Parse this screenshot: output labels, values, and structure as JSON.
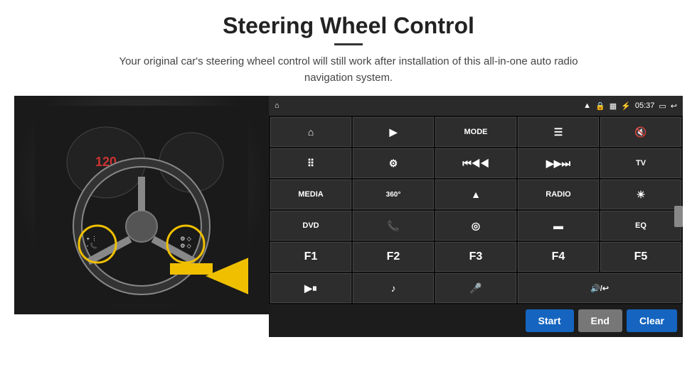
{
  "page": {
    "title": "Steering Wheel Control",
    "subtitle": "Your original car's steering wheel control will still work after installation of this all-in-one auto radio navigation system."
  },
  "status_bar": {
    "time": "05:37",
    "icons": [
      "wifi",
      "lock",
      "sim",
      "bluetooth",
      "volume",
      "screen",
      "back"
    ]
  },
  "buttons": [
    {
      "id": "r0c0",
      "label": "⌂",
      "type": "icon"
    },
    {
      "id": "r0c1",
      "label": "▷",
      "type": "icon"
    },
    {
      "id": "r0c2",
      "label": "MODE",
      "type": "text"
    },
    {
      "id": "r0c3",
      "label": "☰",
      "type": "icon"
    },
    {
      "id": "r0c4",
      "label": "🔇",
      "type": "icon"
    },
    {
      "id": "r0c5",
      "label": "⠿",
      "type": "icon"
    },
    {
      "id": "r1c0",
      "label": "⚙",
      "type": "icon"
    },
    {
      "id": "r1c1",
      "label": "◀|◀◀",
      "type": "icon"
    },
    {
      "id": "r1c2",
      "label": "▶▶|→",
      "type": "icon"
    },
    {
      "id": "r1c3",
      "label": "TV",
      "type": "text"
    },
    {
      "id": "r1c4",
      "label": "MEDIA",
      "type": "text"
    },
    {
      "id": "r2c0",
      "label": "360°",
      "type": "text"
    },
    {
      "id": "r2c1",
      "label": "▲",
      "type": "icon"
    },
    {
      "id": "r2c2",
      "label": "RADIO",
      "type": "text"
    },
    {
      "id": "r2c3",
      "label": "☀",
      "type": "icon"
    },
    {
      "id": "r2c4",
      "label": "DVD",
      "type": "text"
    },
    {
      "id": "r3c0",
      "label": "📞",
      "type": "icon"
    },
    {
      "id": "r3c1",
      "label": "◉",
      "type": "icon"
    },
    {
      "id": "r3c2",
      "label": "▬",
      "type": "icon"
    },
    {
      "id": "r3c3",
      "label": "EQ",
      "type": "text"
    },
    {
      "id": "r3c4",
      "label": "F1",
      "type": "text"
    },
    {
      "id": "r4c0",
      "label": "F2",
      "type": "text"
    },
    {
      "id": "r4c1",
      "label": "F3",
      "type": "text"
    },
    {
      "id": "r4c2",
      "label": "F4",
      "type": "text"
    },
    {
      "id": "r4c3",
      "label": "F5",
      "type": "text"
    },
    {
      "id": "r4c4",
      "label": "▶⏸",
      "type": "icon"
    },
    {
      "id": "r5c0",
      "label": "♪",
      "type": "icon"
    },
    {
      "id": "r5c1",
      "label": "🎤",
      "type": "icon"
    },
    {
      "id": "r5c2",
      "label": "🔊/↩",
      "type": "icon"
    }
  ],
  "bottom_bar": {
    "start_label": "Start",
    "end_label": "End",
    "clear_label": "Clear"
  }
}
